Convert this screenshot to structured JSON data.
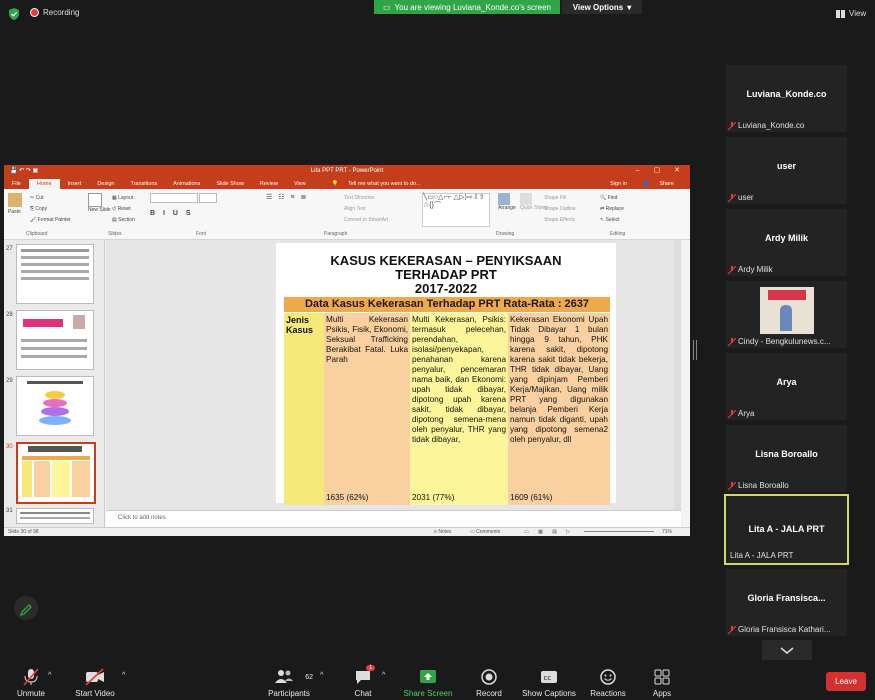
{
  "top_bar": {
    "recording": "Recording",
    "viewing_banner": "You are viewing Luviana_Konde.co's screen",
    "view_options": "View Options",
    "view": "View"
  },
  "ppt": {
    "window_title": "Lita PPT PRT - PowerPoint",
    "tabs": [
      "File",
      "Home",
      "Insert",
      "Design",
      "Transitions",
      "Animations",
      "Slide Show",
      "Review",
      "View"
    ],
    "tell_me": "Tell me what you want to do...",
    "sign_in": "Sign in",
    "share": "Share",
    "ribbon": {
      "paste": "Paste",
      "cut": "Cut",
      "copy": "Copy",
      "format_painter": "Format Painter",
      "clipboard": "Clipboard",
      "new_slide": "New Slide",
      "layout": "Layout",
      "reset": "Reset",
      "section": "Section",
      "slides": "Slides",
      "font": "Font",
      "text_direction": "Text Direction",
      "align_text": "Align Text",
      "convert_smartart": "Convert to SmartArt",
      "paragraph": "Paragraph",
      "arrange": "Arrange",
      "quick_styles": "Quick Styles",
      "shape_fill": "Shape Fill",
      "shape_outline": "Shape Outline",
      "shape_effects": "Shape Effects",
      "drawing": "Drawing",
      "find": "Find",
      "replace": "Replace",
      "select": "Select",
      "editing": "Editing"
    },
    "thumb_numbers": [
      "27",
      "28",
      "29",
      "30",
      "31"
    ],
    "notes_placeholder": "Click to add notes",
    "status_slide": "Slide 30 of 98",
    "status_notes": "Notes",
    "status_comments": "Comments",
    "zoom": "71%"
  },
  "slide": {
    "title_line1": "KASUS KEKERASAN – PENYIKSAAN",
    "title_line2": "TERHADAP PRT",
    "title_line3": "2017-2022",
    "subtitle": "Data Kasus Kekerasan Terhadap PRT Rata-Rata : 2637",
    "col_head": "Jenis Kasus",
    "col1_text": "Multi Kekerasan Psikis, Fisik, Ekonomi, Seksual Trafficking Berakibat Fatal. Luka Parah",
    "col1_pct": "1635 (62%)",
    "col2_text": "Multi Kekerasan, Psikis: termasuk pelecehan, perendahan, isolasi/penyekapan, penahanan karena penyalur, pencemaran nama baik, dan Ekonomi: upah tidak dibayar, dipotong upah karena sakit, tidak dibayar, dipotong semena-mena oleh penyalur, THR yang tidak dibayar,",
    "col2_pct": "2031 (77%)",
    "col3_text": "Kekerasan Ekonomi Upah Tidak Dibayar 1 bulan hingga 9 tahun, PHK karena sakit, dipotong karena sakit tidak bekerja, THR tidak dibayar, Uang yang dipinjam Pemberi Kerja/Majikan, Uang milik PRT yang digunakan belanja Pemberi Kerja namun tidak diganti, upah yang dipotong semena2 oleh penyalur, dll",
    "col3_pct": "1609 (61%)"
  },
  "participants": [
    {
      "name": "Luviana_Konde.co",
      "label": "Luviana_Konde.co"
    },
    {
      "name": "user",
      "label": "user"
    },
    {
      "name": "Ardy Milik",
      "label": "Ardy Milik"
    },
    {
      "name": "",
      "label": "Cindy - Bengkulunews.c..."
    },
    {
      "name": "Arya",
      "label": "Arya"
    },
    {
      "name": "Lisna Boroallo",
      "label": "Lisna Boroallo"
    },
    {
      "name": "Lita A - JALA PRT",
      "label": "Lita A - JALA PRT"
    },
    {
      "name": "Gloria Fransisca...",
      "label": "Gloria Fransisca Kathari..."
    }
  ],
  "toolbar": {
    "unmute": "Unmute",
    "start_video": "Start Video",
    "participants": "Participants",
    "participants_count": "62",
    "chat": "Chat",
    "chat_badge": "1",
    "share_screen": "Share Screen",
    "record": "Record",
    "show_captions": "Show Captions",
    "reactions": "Reactions",
    "apps": "Apps",
    "leave": "Leave"
  },
  "colors": {
    "share_green": "#2fa547",
    "ppt_red": "#c43e1c",
    "leave_red": "#d3302f",
    "active_speaker": "#d4d76a",
    "slide_orange": "#f0a84c",
    "col_yellow": "#fdf59a",
    "col_peach": "#fbd0a0"
  }
}
